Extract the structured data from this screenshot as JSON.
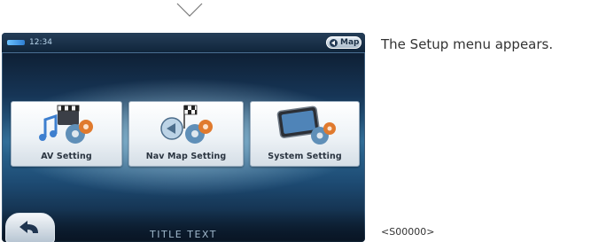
{
  "flow_arrow": "chevron-down-icon",
  "device": {
    "status_bar": {
      "time": "12:34",
      "battery_icon": "battery-icon",
      "map_button_label": "Map"
    },
    "menu_buttons": [
      {
        "label": "AV Setting",
        "icon": "music-film-gear-icon"
      },
      {
        "label": "Nav Map Setting",
        "icon": "globe-flag-gear-icon"
      },
      {
        "label": "System Setting",
        "icon": "device-gear-icon"
      }
    ],
    "back_button_icon": "back-arrow-icon",
    "title_text": "TITLE TEXT"
  },
  "caption": "The Setup menu appears.",
  "screen_code": "<S00000>",
  "colors": {
    "screen_background": "#1d4a72",
    "button_face": "#eef3f7",
    "gear_orange": "#e07a2e",
    "gear_blue": "#5f8fb8",
    "label_text": "#2a3440"
  }
}
